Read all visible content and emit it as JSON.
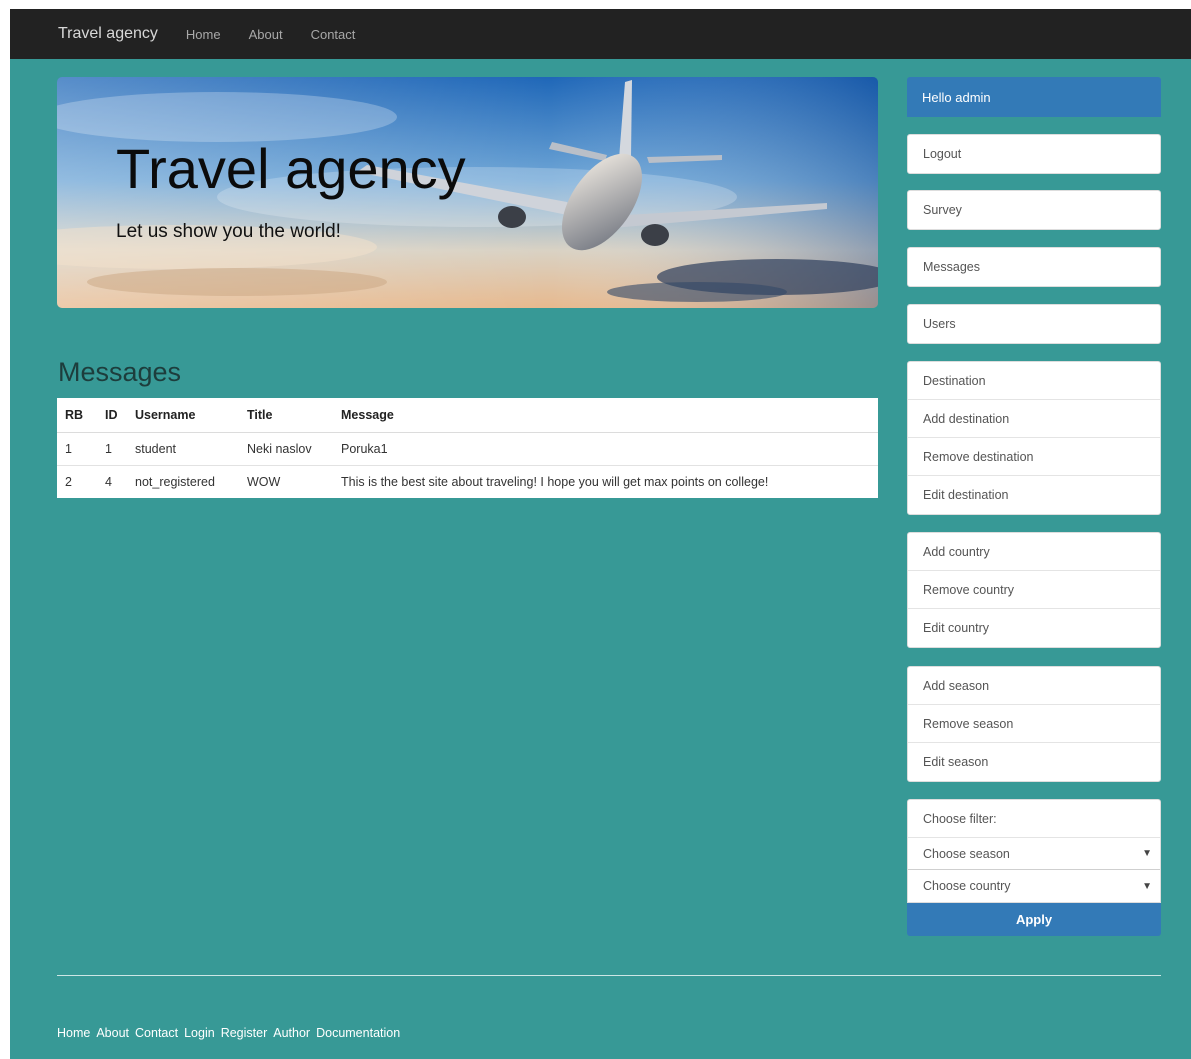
{
  "navbar": {
    "brand": "Travel agency",
    "links": [
      "Home",
      "About",
      "Contact"
    ]
  },
  "hero": {
    "title": "Travel agency",
    "subtitle": "Let us show you the world!"
  },
  "messages": {
    "heading": "Messages",
    "columns": [
      "RB",
      "ID",
      "Username",
      "Title",
      "Message"
    ],
    "rows": [
      [
        "1",
        "1",
        "student",
        "Neki naslov",
        "Poruka1"
      ],
      [
        "2",
        "4",
        "not_registered",
        "WOW",
        "This is the best site about traveling! I hope you will get max points on college!"
      ]
    ]
  },
  "sidebar": {
    "greeting": "Hello admin",
    "logout": "Logout",
    "survey": "Survey",
    "messages": "Messages",
    "users": "Users",
    "destination_group": [
      "Destination",
      "Add destination",
      "Remove destination",
      "Edit destination"
    ],
    "country_group": [
      "Add country",
      "Remove country",
      "Edit country"
    ],
    "season_group": [
      "Add season",
      "Remove season",
      "Edit season"
    ],
    "filter": {
      "label": "Choose filter:",
      "season_select": "Choose season",
      "country_select": "Choose country",
      "apply": "Apply"
    }
  },
  "footer": {
    "links": [
      "Home",
      "About",
      "Contact",
      "Login",
      "Register",
      "Author",
      "Documentation"
    ]
  },
  "colors": {
    "page_background": "#379996",
    "navbar": "#222222",
    "primary": "#337ab7"
  }
}
